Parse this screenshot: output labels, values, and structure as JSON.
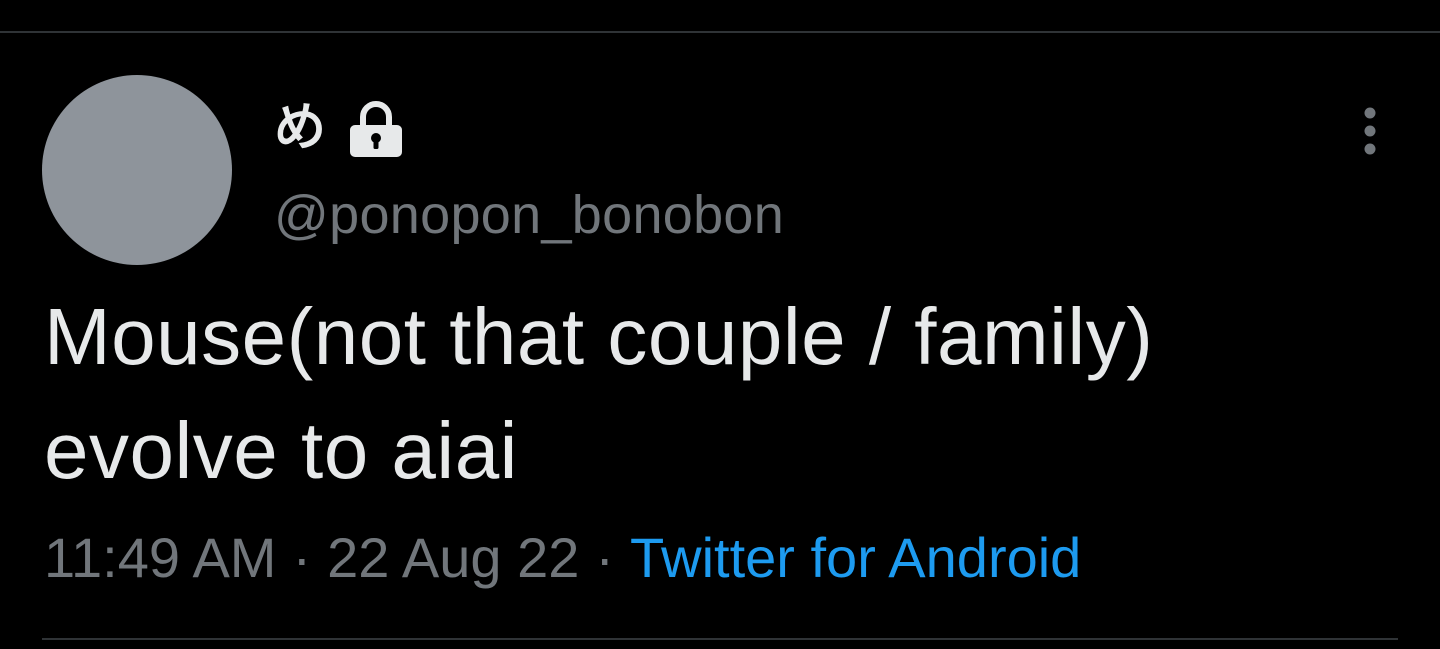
{
  "tweet": {
    "display_name": "め",
    "handle": "@ponopon_bonobon",
    "text": "Mouse(not that couple / family)\nevolve to aiai",
    "time": "11:49 AM",
    "separator": "·",
    "date": "22 Aug 22",
    "source": "Twitter for Android",
    "icons": {
      "protected": "lock-icon",
      "more": "more-vertical-icon"
    }
  },
  "colors": {
    "background": "#000000",
    "text": "#e7e9ea",
    "secondary_text": "#71767b",
    "link": "#1d9bf0",
    "divider": "#2f3336",
    "avatar": "#8e949b"
  }
}
